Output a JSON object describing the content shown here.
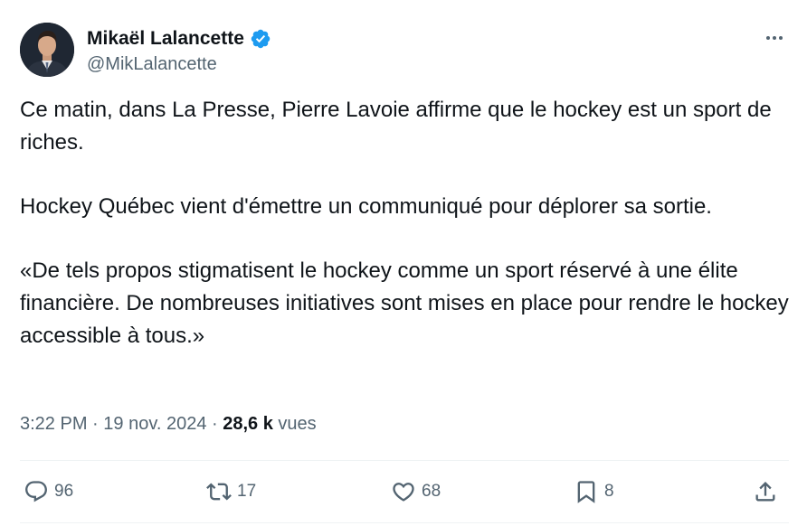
{
  "author": {
    "display_name": "Mikaël Lalancette",
    "handle": "@MikLalancette"
  },
  "body": {
    "paragraphs": [
      "Ce matin, dans La Presse, Pierre Lavoie affirme que le hockey est un sport de riches.",
      "Hockey Québec vient d'émettre un communiqué pour déplorer sa sortie.",
      "«De tels propos stigmatisent le hockey comme un sport réservé à une élite financière. De nombreuses initiatives sont mises en place pour rendre le hockey accessible à tous.»"
    ]
  },
  "meta": {
    "time": "3:22 PM",
    "separator": "·",
    "date": "19 nov. 2024",
    "views_count": "28,6 k",
    "views_label": "vues"
  },
  "actions": {
    "replies": "96",
    "reposts": "17",
    "likes": "68",
    "bookmarks": "8"
  },
  "colors": {
    "verified": "#1d9bf0",
    "secondary_text": "#536471",
    "primary_text": "#0f1419",
    "divider": "#eff3f4"
  },
  "icons": {
    "verified": "verified-badge-icon",
    "more": "more-horizontal-icon",
    "reply": "reply-icon",
    "retweet": "retweet-icon",
    "like": "heart-icon",
    "bookmark": "bookmark-icon",
    "share": "share-icon"
  }
}
